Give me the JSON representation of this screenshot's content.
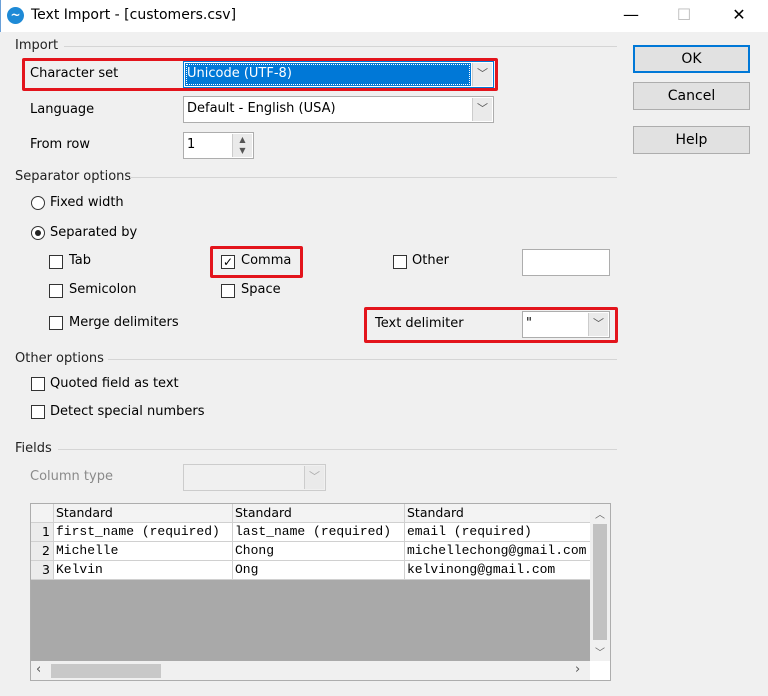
{
  "window": {
    "title": "Text Import - [customers.csv]",
    "minimize": "—",
    "maximize": "☐",
    "close": "✕"
  },
  "import": {
    "section": "Import",
    "charset_label": "Character set",
    "charset_value": "Unicode (UTF-8)",
    "language_label": "Language",
    "language_value": "Default - English (USA)",
    "fromrow_label": "From row",
    "fromrow_value": "1"
  },
  "separator": {
    "section": "Separator options",
    "fixed_width": "Fixed width",
    "separated_by": "Separated by",
    "tab": "Tab",
    "comma": "Comma",
    "other": "Other",
    "other_value": "",
    "semicolon": "Semicolon",
    "space": "Space",
    "merge": "Merge delimiters",
    "text_delim_label": "Text delimiter",
    "text_delim_value": "\"",
    "mode": "separated_by",
    "checked": {
      "tab": false,
      "comma": true,
      "other": false,
      "semicolon": false,
      "space": false,
      "merge": false
    }
  },
  "other_options": {
    "section": "Other options",
    "quoted": "Quoted field as text",
    "detect": "Detect special numbers"
  },
  "fields": {
    "section": "Fields",
    "column_type_label": "Column type",
    "column_type_value": "",
    "headers": [
      "Standard",
      "Standard",
      "Standard"
    ],
    "rows": [
      [
        "1",
        "first_name (required)",
        "last_name (required)",
        "email (required)"
      ],
      [
        "2",
        "Michelle",
        "Chong",
        "michellechong@gmail.com"
      ],
      [
        "3",
        "Kelvin",
        "Ong",
        "kelvinong@gmail.com"
      ]
    ]
  },
  "buttons": {
    "ok": "OK",
    "cancel": "Cancel",
    "help": "Help"
  },
  "colors": {
    "accent": "#0078d7",
    "highlight": "#e3141c"
  }
}
